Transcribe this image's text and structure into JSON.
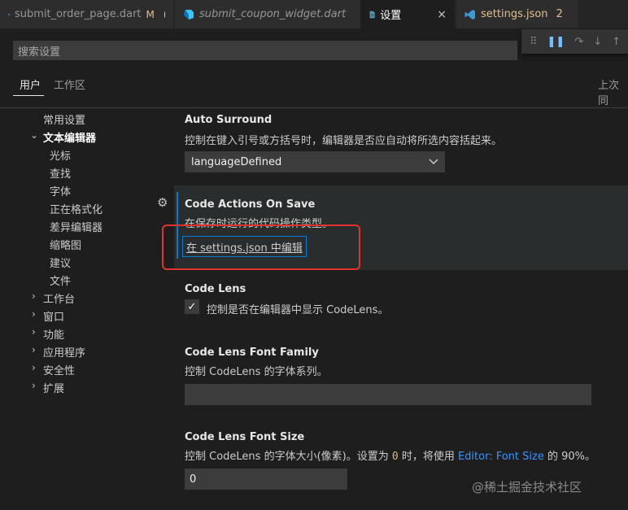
{
  "tabs": [
    {
      "label": "submit_order_page.dart",
      "mod": "M"
    },
    {
      "label": "submit_coupon_widget.dart"
    },
    {
      "label": "设置",
      "close": "×"
    },
    {
      "label": "settings.json",
      "count": "2"
    }
  ],
  "debug_toolbar": {
    "grip": "⠿",
    "pause": "❚❚",
    "step_over": "↷",
    "step_into": "↓",
    "step_out": "↑"
  },
  "search": {
    "placeholder": "搜索设置"
  },
  "scope_tabs": {
    "user": "用户",
    "workspace": "工作区",
    "last_sync": "上次同"
  },
  "toc": {
    "common": "常用设置",
    "text_editor": "文本编辑器",
    "children": [
      "光标",
      "查找",
      "字体",
      "正在格式化",
      "差异编辑器",
      "缩略图",
      "建议",
      "文件"
    ],
    "collapsed": [
      "工作台",
      "窗口",
      "功能",
      "应用程序",
      "安全性",
      "扩展"
    ]
  },
  "settings": {
    "auto_surround": {
      "title": "Auto Surround",
      "desc": "控制在键入引号或方括号时，编辑器是否应自动将所选内容括起来。",
      "value": "languageDefined"
    },
    "code_actions": {
      "title": "Code Actions On Save",
      "desc": "在保存时运行的代码操作类型。",
      "link": "在 settings.json 中编辑"
    },
    "code_lens": {
      "title": "Code Lens",
      "desc": "控制是否在编辑器中显示 CodeLens。"
    },
    "font_family": {
      "title": "Code Lens Font Family",
      "desc": "控制 CodeLens 的字体系列。",
      "value": ""
    },
    "font_size": {
      "title": "Code Lens Font Size",
      "desc_pre": "控制 CodeLens 的字体大小(像素)。设置为 ",
      "desc_code": "0",
      "desc_mid": " 时，将使用 ",
      "desc_link": "Editor: Font Size",
      "desc_post": " 的 90%。",
      "value": "0"
    }
  },
  "watermark": "@稀土掘金技术社区",
  "colors": {
    "accent": "#007acc",
    "highlight": "#e0342b",
    "modified": "#e2c08d",
    "dart": "#40c4ff"
  }
}
